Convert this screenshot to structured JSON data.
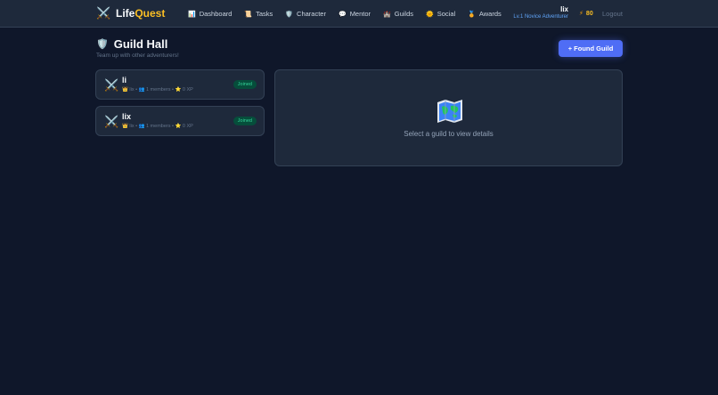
{
  "app": {
    "name_part1": "Life",
    "name_part2": "Quest",
    "logo_icon": "crossed-swords-icon"
  },
  "nav": [
    {
      "label": "Dashboard",
      "icon": "bar-chart-icon"
    },
    {
      "label": "Tasks",
      "icon": "scroll-icon"
    },
    {
      "label": "Character",
      "icon": "shield-icon"
    },
    {
      "label": "Mentor",
      "icon": "speech-bubble-icon"
    },
    {
      "label": "Guilds",
      "icon": "castle-icon"
    },
    {
      "label": "Social",
      "icon": "sun-icon"
    },
    {
      "label": "Awards",
      "icon": "medal-icon"
    }
  ],
  "user": {
    "name": "lix",
    "level": "Lv.1 Novice Adventurer",
    "coins": "80",
    "logout": "Logout"
  },
  "page": {
    "title": "Guild Hall",
    "subtitle": "Team up with other adventurers!",
    "found_button": "+ Found Guild"
  },
  "guilds": [
    {
      "name": "li",
      "owner": "lix",
      "members": "1 members",
      "xp": "0 XP",
      "status": "Joined"
    },
    {
      "name": "lix",
      "owner": "lix",
      "members": "1 members",
      "xp": "0 XP",
      "status": "Joined"
    }
  ],
  "detail": {
    "empty_text": "Select a guild to view details",
    "icon": "map-icon"
  },
  "colors": {
    "background": "#0f172a",
    "panel": "#1e293b",
    "accent": "#4f6df5",
    "gold": "#fbbf24",
    "joined_badge": "#34d399"
  }
}
